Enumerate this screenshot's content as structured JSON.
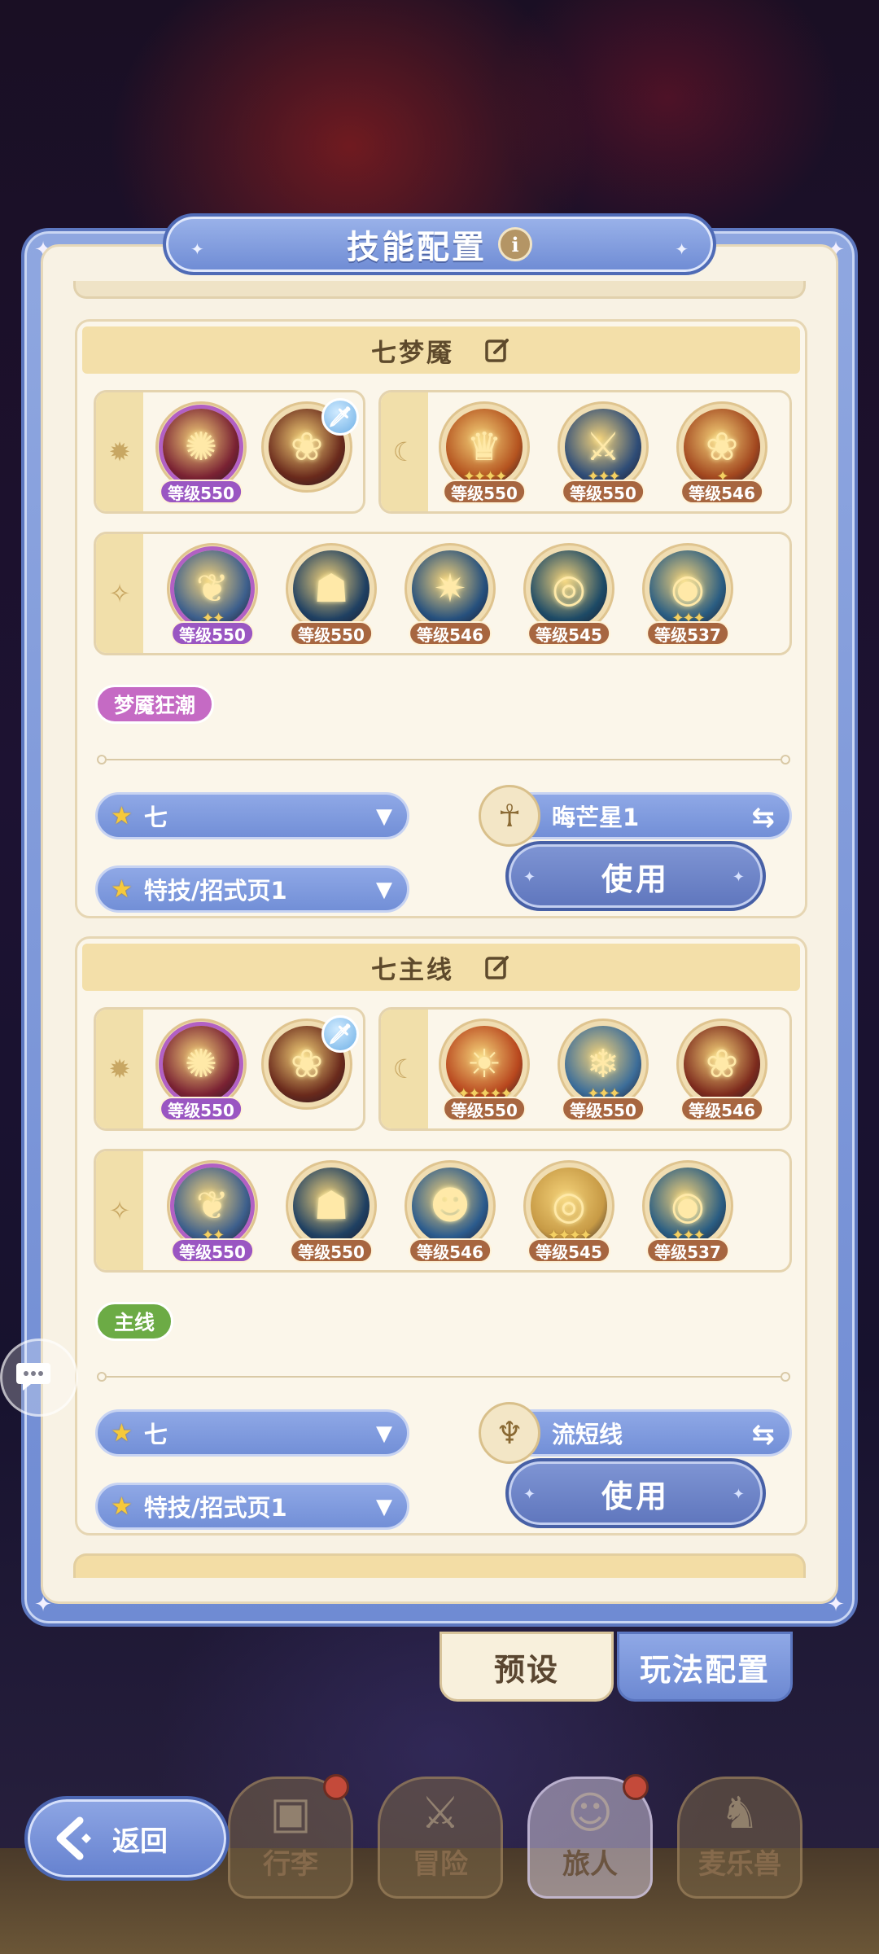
{
  "header": {
    "title": "技能配置"
  },
  "loadouts": [
    {
      "name": "七梦魇",
      "row1_left": [
        {
          "icon": "crimson-wheel-icon",
          "glyph": "✺",
          "level": "等级550",
          "level_style": "violet",
          "orb": "#7a2233",
          "stars": "",
          "purple": true
        },
        {
          "icon": "golden-rose-icon",
          "glyph": "❀",
          "level": "",
          "level_style": "",
          "orb": "#6a2a1c",
          "stars": "",
          "purple": false,
          "badge": true
        }
      ],
      "row1_right": [
        {
          "icon": "flame-crown-icon",
          "glyph": "♛",
          "level": "等级550",
          "level_style": "brown",
          "orb": "#b4531f",
          "stars": "✦✦✦✦",
          "purple": false
        },
        {
          "icon": "golden-blade-icon",
          "glyph": "⚔",
          "level": "等级550",
          "level_style": "brown",
          "orb": "#2f4d77",
          "stars": "✦✦✦",
          "purple": false
        },
        {
          "icon": "golden-rose-icon",
          "glyph": "❀",
          "level": "等级546",
          "level_style": "brown",
          "orb": "#a2471f",
          "stars": "✦",
          "purple": false
        }
      ],
      "row2": [
        {
          "icon": "golden-wings-icon",
          "glyph": "❦",
          "level": "等级550",
          "level_style": "violet",
          "orb": "#3d5f8c",
          "stars": "✦✦",
          "purple": true
        },
        {
          "icon": "shadow-claw-icon",
          "glyph": "☗",
          "level": "等级550",
          "level_style": "brown",
          "orb": "#1f4062",
          "stars": "",
          "purple": false
        },
        {
          "icon": "lightning-burst-icon",
          "glyph": "✷",
          "level": "等级546",
          "level_style": "brown",
          "orb": "#26507d",
          "stars": "",
          "purple": false
        },
        {
          "icon": "spiral-vortex-icon",
          "glyph": "◎",
          "level": "等级545",
          "level_style": "brown",
          "orb": "#1d4a66",
          "stars": "",
          "purple": false
        },
        {
          "icon": "all-seeing-eye-icon",
          "glyph": "◉",
          "level": "等级537",
          "level_style": "brown",
          "orb": "#2a5d82",
          "stars": "✦✦✦",
          "purple": false
        }
      ],
      "tag": "梦魇狂潮",
      "tag_color": "#c56ac4",
      "team": "七",
      "page": "特技/招式页1",
      "partner": "晦芒星1",
      "partner_icon": "☥",
      "use": "使用"
    },
    {
      "name": "七主线",
      "row1_left": [
        {
          "icon": "crimson-wheel-icon",
          "glyph": "✺",
          "level": "等级550",
          "level_style": "violet",
          "orb": "#7a2233",
          "stars": "",
          "purple": true
        },
        {
          "icon": "golden-rose-icon",
          "glyph": "❀",
          "level": "",
          "level_style": "",
          "orb": "#6a2a1c",
          "stars": "",
          "purple": false,
          "badge": true
        }
      ],
      "row1_right": [
        {
          "icon": "radiant-sun-icon",
          "glyph": "☀",
          "level": "等级550",
          "level_style": "brown",
          "orb": "#b8471e",
          "stars": "✦✦✦✦✦",
          "purple": false
        },
        {
          "icon": "ice-shard-icon",
          "glyph": "❄",
          "level": "等级550",
          "level_style": "brown",
          "orb": "#3c6d99",
          "stars": "✦✦✦",
          "purple": false
        },
        {
          "icon": "golden-rose-icon",
          "glyph": "❀",
          "level": "等级546",
          "level_style": "brown",
          "orb": "#7d2b1d",
          "stars": "",
          "purple": false
        }
      ],
      "row2": [
        {
          "icon": "golden-wings-icon",
          "glyph": "❦",
          "level": "等级550",
          "level_style": "violet",
          "orb": "#3d5f8c",
          "stars": "✦✦",
          "purple": true
        },
        {
          "icon": "shadow-claw-icon",
          "glyph": "☗",
          "level": "等级550",
          "level_style": "brown",
          "orb": "#1f4062",
          "stars": "",
          "purple": false
        },
        {
          "icon": "electric-mask-icon",
          "glyph": "☻",
          "level": "等级546",
          "level_style": "brown",
          "orb": "#2b5b8d",
          "stars": "",
          "purple": false
        },
        {
          "icon": "golden-whirl-icon",
          "glyph": "◎",
          "level": "等级545",
          "level_style": "brown",
          "orb": "#c79a45",
          "stars": "✦✦✦✦",
          "purple": false
        },
        {
          "icon": "all-seeing-eye-icon",
          "glyph": "◉",
          "level": "等级537",
          "level_style": "brown",
          "orb": "#2a5d82",
          "stars": "✦✦✦",
          "purple": false
        }
      ],
      "tag": "主线",
      "tag_color": "#6cab45",
      "team": "七",
      "page": "特技/招式页1",
      "partner": "流短线",
      "partner_icon": "♆",
      "use": "使用"
    }
  ],
  "tabs": {
    "preset": "预设",
    "play_config": "玩法配置"
  },
  "back": "返回",
  "nav": [
    {
      "label": "行李",
      "icon": "luggage-icon",
      "glyph": "▣",
      "dot": true,
      "active": false
    },
    {
      "label": "冒险",
      "icon": "crossed-swords-icon",
      "glyph": "⚔",
      "dot": false,
      "active": false
    },
    {
      "label": "旅人",
      "icon": "traveler-avatar-icon",
      "glyph": "☺",
      "dot": true,
      "active": true
    },
    {
      "label": "麦乐兽",
      "icon": "fox-pet-icon",
      "glyph": "♞",
      "dot": false,
      "active": false
    }
  ]
}
